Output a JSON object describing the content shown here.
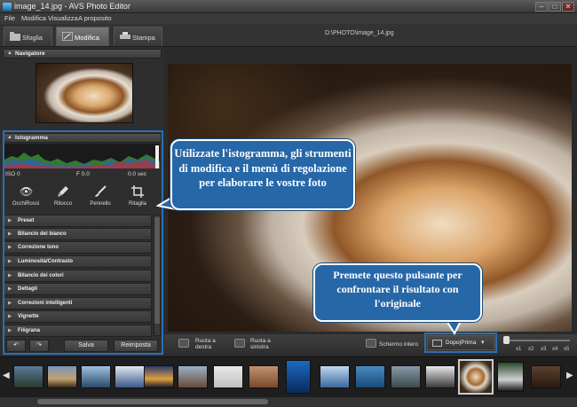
{
  "window": {
    "title": "image_14.jpg - AVS Photo Editor",
    "minimize": "–",
    "maximize": "□",
    "close": "✕"
  },
  "menu": [
    "File",
    "Modifica",
    "Visualizza",
    "A proposito"
  ],
  "tabs": [
    {
      "label": "Sfoglia"
    },
    {
      "label": "Modifica"
    },
    {
      "label": "Stampa"
    }
  ],
  "filepath": "D:\\PHOTO\\image_14.jpg",
  "navigator": {
    "title": "Navigatore"
  },
  "histogram": {
    "title": "Istogramma",
    "iso": "ISO 0",
    "fstop": "F 0.0",
    "shutter": "0.0 sec"
  },
  "tools": [
    {
      "label": "OcchiRossi",
      "icon": "eye-icon"
    },
    {
      "label": "Ritocco",
      "icon": "brush-retouch-icon"
    },
    {
      "label": "Pennello",
      "icon": "paintbrush-icon"
    },
    {
      "label": "Ritaglia",
      "icon": "crop-icon"
    }
  ],
  "adjustments": [
    "Preset",
    "Bilancio del bianco",
    "Correzione tono",
    "Luminosità/Contrasto",
    "Bilancio dei colori",
    "Dettagli",
    "Correzioni intelligenti",
    "Vignette",
    "Filigrana"
  ],
  "buttons": {
    "save": "Salva",
    "reset": "Reimposta"
  },
  "bottombar": {
    "rotate_right": "Ruota a destra",
    "rotate_left": "Ruota a sinistra",
    "fullscreen": "Schermo intero",
    "compare": "Dopo|Prima"
  },
  "zoom_levels": [
    "x1",
    "x2",
    "x3",
    "x4",
    "x5"
  ],
  "zoom_value": 0,
  "tips": {
    "tip1": "Utilizzate l'istogramma, gli strumenti di modifica e il menù di regolazione per elaborare le vostre foto",
    "tip2": "Premete questo pulsante per confrontare il risultato con l'originale"
  }
}
